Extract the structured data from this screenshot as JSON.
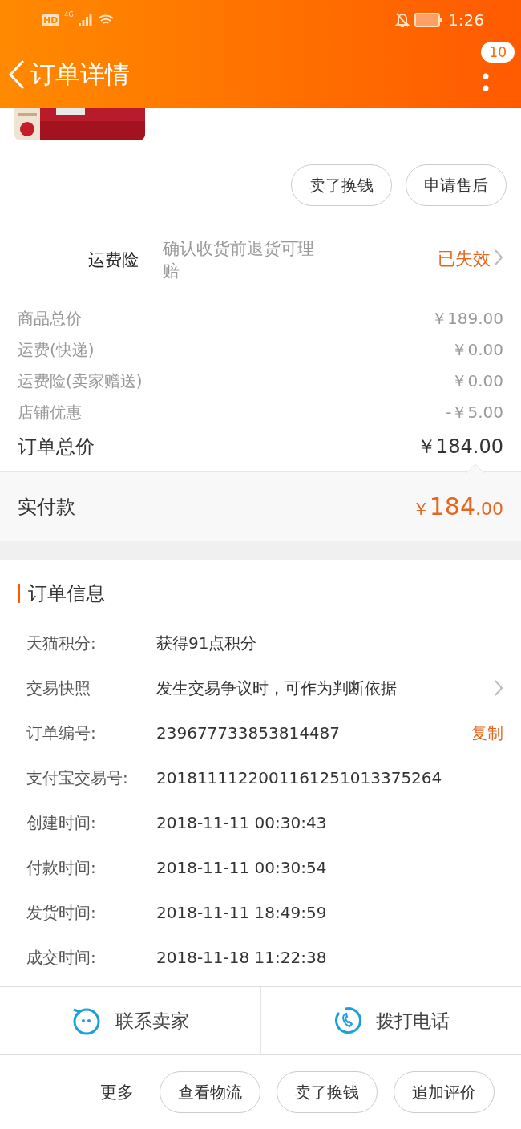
{
  "status_bar": {
    "hd": "HD",
    "network": "4G",
    "time": "1:26"
  },
  "header": {
    "title": "订单详情",
    "badge": "10"
  },
  "actions": [
    "卖了换钱",
    "申请售后"
  ],
  "insurance": {
    "label": "运费险",
    "description": "确认收货前退货可理赔",
    "status": "已失效"
  },
  "price_rows": [
    {
      "label": "商品总价",
      "value": "￥189.00"
    },
    {
      "label": "运费(快递)",
      "value": "￥0.00"
    },
    {
      "label": "运费险(卖家赠送)",
      "value": "￥0.00"
    },
    {
      "label": "店铺优惠",
      "value": "-￥5.00"
    }
  ],
  "total": {
    "label": "订单总价",
    "value": "￥184.00"
  },
  "paid": {
    "label": "实付款",
    "currency": "￥",
    "integer": "184",
    "decimal": ".00"
  },
  "order_info": {
    "title": "订单信息",
    "rows": [
      {
        "kind": "text",
        "label": "天猫积分:",
        "value": "获得91点积分"
      },
      {
        "kind": "link",
        "label": "交易快照",
        "value": "发生交易争议时，可作为判断依据"
      },
      {
        "kind": "copy",
        "label": "订单编号:",
        "value": "239677733853814487",
        "action": "复制"
      },
      {
        "kind": "text",
        "label": "支付宝交易号:",
        "value": "2018111122001161251013375264"
      },
      {
        "kind": "text",
        "label": "创建时间:",
        "value": "2018-11-11 00:30:43"
      },
      {
        "kind": "text",
        "label": "付款时间:",
        "value": "2018-11-11 00:30:54"
      },
      {
        "kind": "text",
        "label": "发货时间:",
        "value": "2018-11-11 18:49:59"
      },
      {
        "kind": "text",
        "label": "成交时间:",
        "value": "2018-11-18 11:22:38"
      }
    ]
  },
  "contact": [
    {
      "kind": "chat",
      "label": "联系卖家"
    },
    {
      "kind": "phone",
      "label": "拨打电话"
    }
  ],
  "more": {
    "label": "更多",
    "buttons": [
      "查看物流",
      "卖了换钱",
      "追加评价"
    ]
  }
}
